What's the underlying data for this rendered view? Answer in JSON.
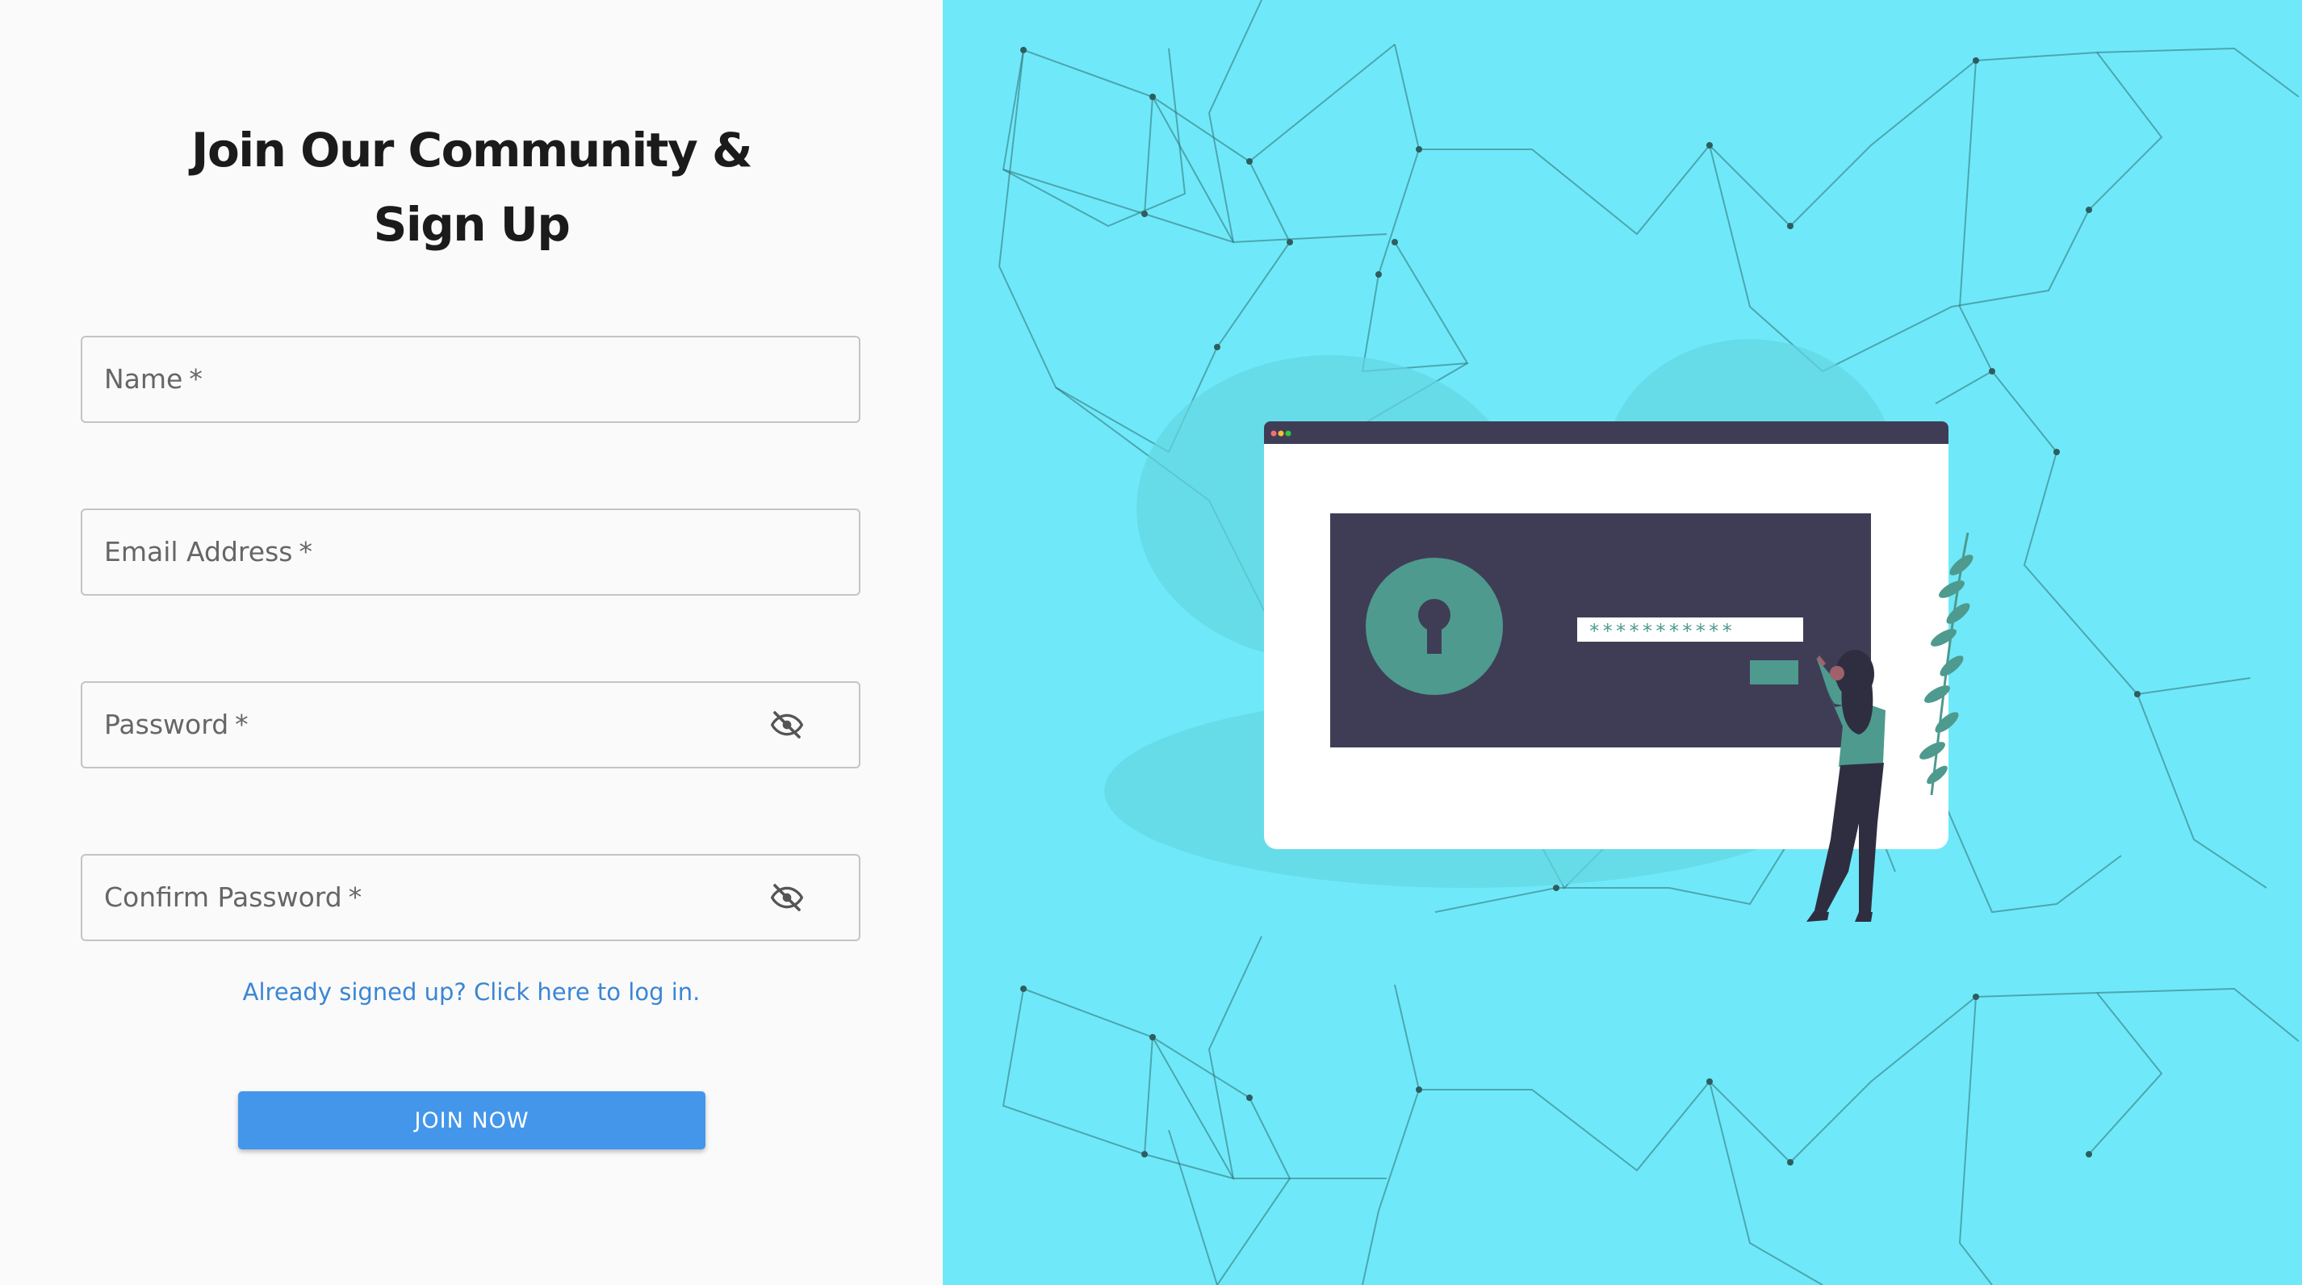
{
  "signup": {
    "title_line1": "Join Our Community &",
    "title_line2": "Sign Up",
    "fields": [
      {
        "label": "Name",
        "required_marker": "*"
      },
      {
        "label": "Email Address",
        "required_marker": "*"
      },
      {
        "label": "Password",
        "required_marker": "*",
        "icon": "eye-off-icon"
      },
      {
        "label": "Confirm Password",
        "required_marker": "*",
        "icon": "eye-off-icon"
      }
    ],
    "login_link": "Already signed up? Click here to log in.",
    "submit_label": "JOIN NOW"
  },
  "illustration": {
    "password_mask": "***********",
    "background_color": "#6fe9f9",
    "panel_color": "#3f3d56",
    "accent_color": "#4e9a8e"
  },
  "colors": {
    "button": "#4496ea",
    "link": "#3a86d4",
    "left_background": "#fafafa"
  }
}
